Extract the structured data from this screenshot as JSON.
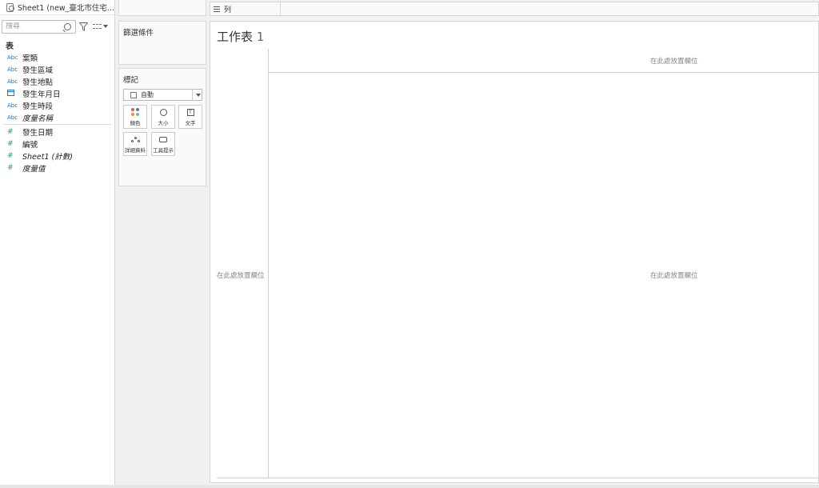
{
  "data_pane": {
    "datasource": "Sheet1 (new_臺北市住宅...",
    "search_placeholder": "搜尋",
    "section_title": "表",
    "dimensions": [
      {
        "type": "Abc",
        "name": "案類"
      },
      {
        "type": "Abc",
        "name": "發生區域"
      },
      {
        "type": "Abc",
        "name": "發生地點"
      },
      {
        "type": "calendar",
        "name": "發生年月日"
      },
      {
        "type": "Abc",
        "name": "發生時段"
      },
      {
        "type": "Abc",
        "name": "度量名稱"
      }
    ],
    "measures": [
      {
        "type": "#",
        "name": "發生日期"
      },
      {
        "type": "#",
        "name": "編號"
      },
      {
        "type": "#",
        "name": "Sheet1 (計數)"
      },
      {
        "type": "#",
        "name": "度量值"
      }
    ]
  },
  "filters_card": {
    "title": "篩選條件"
  },
  "marks_card": {
    "title": "標記",
    "mark_type": "自動",
    "buttons": {
      "color": "顏色",
      "size": "大小",
      "text": "文字",
      "detail": "詳細資料",
      "tooltip": "工具提示"
    },
    "dot_colors": [
      "#e15759",
      "#4e79a7",
      "#f28e2b",
      "#76b7b2"
    ]
  },
  "columns_shelf": {
    "label": "列"
  },
  "worksheet": {
    "title_text": "工作表",
    "title_num": "1",
    "drop_columns_hint": "在此處放置欄位",
    "drop_rows_hint": "在此處放置欄位",
    "drop_body_hint": "在此處放置欄位"
  }
}
